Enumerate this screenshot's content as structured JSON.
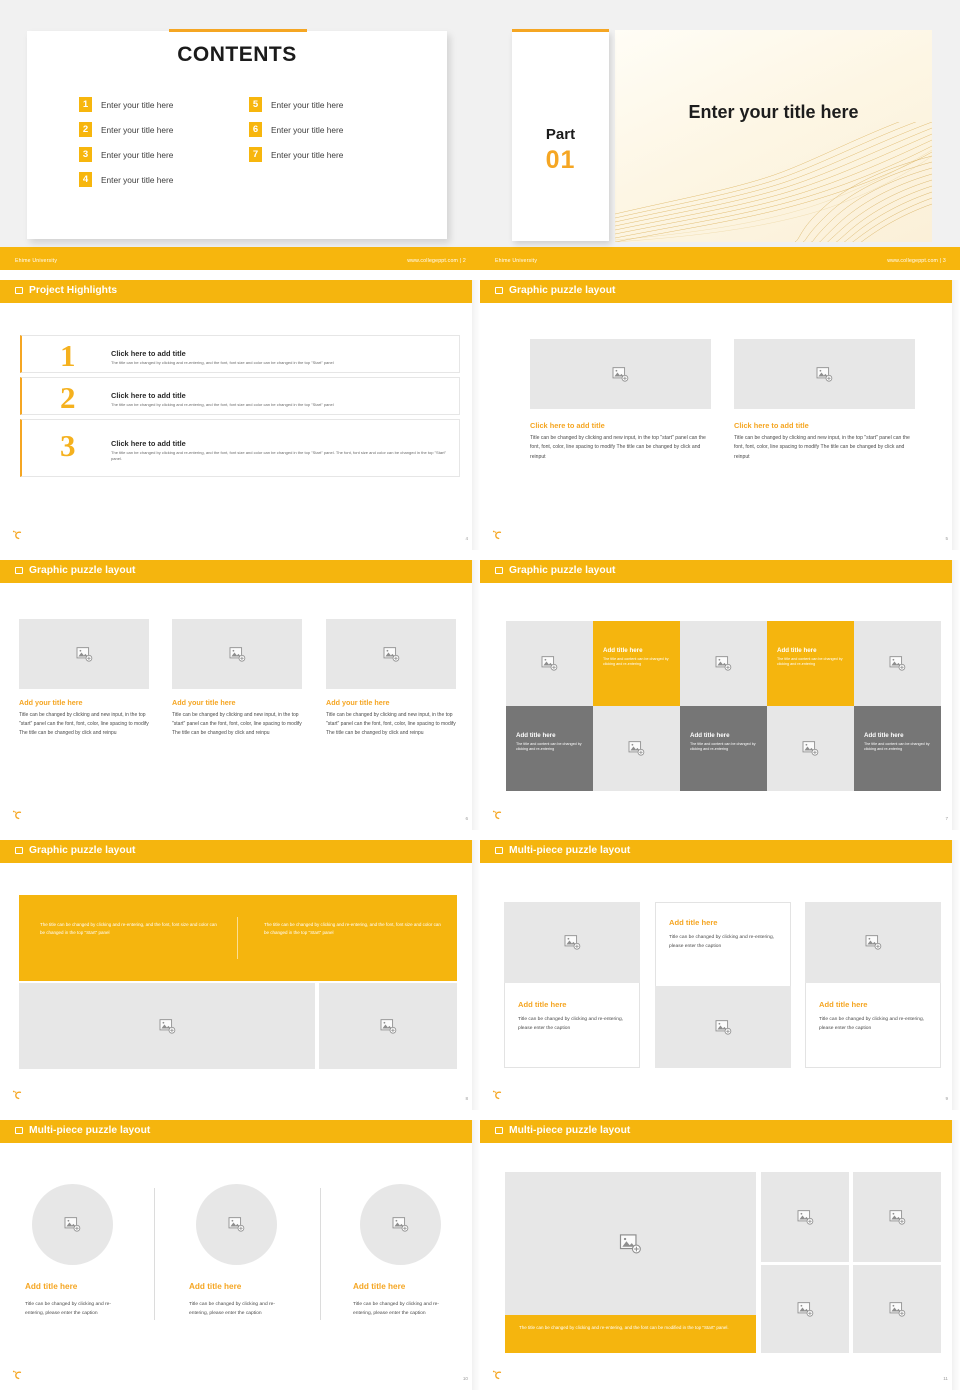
{
  "brand": {
    "yellow": "#f5b50e",
    "orange": "#f5a623",
    "dark_gray": "#767676",
    "light_gray": "#e7e7e7",
    "footer_left": "Ehime University",
    "footer_right": "www.collegeppt.com  |",
    "logo_icon": "c-logo-icon"
  },
  "slides": [
    {
      "number": "2",
      "kind": "contents",
      "title": "CONTENTS",
      "footer_left": "Ehime University",
      "footer_right": "www.collegeppt.com  |  2",
      "items": [
        {
          "num": "1",
          "label": "Enter your title here"
        },
        {
          "num": "2",
          "label": "Enter your title here"
        },
        {
          "num": "3",
          "label": "Enter your title here"
        },
        {
          "num": "4",
          "label": "Enter your title here"
        },
        {
          "num": "5",
          "label": "Enter your title here"
        },
        {
          "num": "6",
          "label": "Enter your title here"
        },
        {
          "num": "7",
          "label": "Enter your title here"
        }
      ]
    },
    {
      "number": "3",
      "kind": "section",
      "part_word": "Part",
      "part_num": "01",
      "hero_title": "Enter your title here",
      "footer_left": "Ehime University",
      "footer_right": "www.collegeppt.com  |  3"
    },
    {
      "number": "4",
      "kind": "highlights",
      "header": "Project Highlights",
      "rows": [
        {
          "num": "1",
          "title": "Click here to add title",
          "desc": "The title can be changed by clicking and re-entering, and the font, font size and color can be changed in the top \"Start\" panel"
        },
        {
          "num": "2",
          "title": "Click here to add title",
          "desc": "The title can be changed by clicking and re-entering, and the font, font size and color can be changed in the top \"Start\" panel"
        },
        {
          "num": "3",
          "title": "Click here to add title",
          "desc": "The title can be changed by clicking and re-entering, and the font, font size and color can be changed in the top \"Start\" panel. The font, font size and color can be changed in the top \"Start\" panel."
        }
      ]
    },
    {
      "number": "5",
      "kind": "two-image",
      "header": "Graphic puzzle layout",
      "blocks": [
        {
          "title": "Click here to add title",
          "desc": "Title can be changed by clicking and new input, in the top \"start\" panel can the font, font, color, line spacing to modify The title can be changed by click and reinput"
        },
        {
          "title": "Click here to add title",
          "desc": "Title can be changed by clicking and new input, in the top \"start\" panel can the font, font, color, line spacing to modify The title can be changed by click and reinput"
        }
      ]
    },
    {
      "number": "6",
      "kind": "three-image",
      "header": "Graphic puzzle layout",
      "blocks": [
        {
          "title": "Add your title here",
          "desc": "Title can be changed by clicking and new input, in the top \"start\" panel can the font, font, color, line spacing to modify The title can be changed by click and reinpu"
        },
        {
          "title": "Add your title here",
          "desc": "Title can be changed by clicking and new input, in the top \"start\" panel can the font, font, color, line spacing to modify The title can be changed by click and reinpu"
        },
        {
          "title": "Add your title here",
          "desc": "Title can be changed by clicking and new input, in the top \"start\" panel can the font, font, color, line spacing to modify The title can be changed by click and reinpu"
        }
      ]
    },
    {
      "number": "7",
      "kind": "tile-grid",
      "header": "Graphic puzzle layout",
      "tiles": [
        {
          "row": 1,
          "col": 1,
          "fill": "light",
          "type": "image"
        },
        {
          "row": 1,
          "col": 2,
          "fill": "yellow",
          "type": "text",
          "title": "Add title here",
          "desc": "The title and content can be changed by clicking and re-entering"
        },
        {
          "row": 1,
          "col": 3,
          "fill": "light",
          "type": "image"
        },
        {
          "row": 1,
          "col": 4,
          "fill": "yellow",
          "type": "text",
          "title": "Add title here",
          "desc": "The title and content can be changed by clicking and re-entering"
        },
        {
          "row": 1,
          "col": 5,
          "fill": "light",
          "type": "image"
        },
        {
          "row": 2,
          "col": 1,
          "fill": "dark",
          "type": "text",
          "title": "Add title here",
          "desc": "The title and content can be changed by clicking and re-entering"
        },
        {
          "row": 2,
          "col": 2,
          "fill": "light",
          "type": "image"
        },
        {
          "row": 2,
          "col": 3,
          "fill": "dark",
          "type": "text",
          "title": "Add title here",
          "desc": "The title and content can be changed by clicking and re-entering"
        },
        {
          "row": 2,
          "col": 4,
          "fill": "light",
          "type": "image"
        },
        {
          "row": 2,
          "col": 5,
          "fill": "dark",
          "type": "text",
          "title": "Add title here",
          "desc": "The title and content can be changed by clicking and re-entering"
        }
      ]
    },
    {
      "number": "8",
      "kind": "band-two-image",
      "header": "Graphic puzzle layout",
      "band_texts": [
        "The title can be changed by clicking and re-entering, and the font, font size and color can be changed in the top \"Start\" panel",
        "The title can be changed by clicking and re-entering, and the font, font size and color can be changed in the top \"Start\" panel"
      ]
    },
    {
      "number": "9",
      "kind": "stagger-three",
      "header": "Multi-piece puzzle layout",
      "cells": [
        {
          "title": "Add title here",
          "desc": "Title can be changed by clicking and re-entering, please enter the caption",
          "position": "below"
        },
        {
          "title": "Add title here",
          "desc": "Title can be changed by clicking and re-entering, please enter the caption",
          "position": "above"
        },
        {
          "title": "Add title here",
          "desc": "Title can be changed by clicking and re-entering, please enter the caption",
          "position": "below"
        }
      ]
    },
    {
      "number": "10",
      "kind": "circles-three",
      "header": "Multi-piece puzzle layout",
      "cells": [
        {
          "title": "Add title here",
          "desc": "Title can be changed by clicking and re-entering, please enter the caption"
        },
        {
          "title": "Add title here",
          "desc": "Title can be changed by clicking and re-entering, please enter the caption"
        },
        {
          "title": "Add title here",
          "desc": "Title can be changed by clicking and re-entering, please enter the caption"
        }
      ]
    },
    {
      "number": "11",
      "kind": "hero-grid",
      "header": "Multi-piece puzzle layout",
      "caption": "The title can be changed by clicking and re-entering, and the font can be modified in the top \"Start\" panel."
    }
  ]
}
